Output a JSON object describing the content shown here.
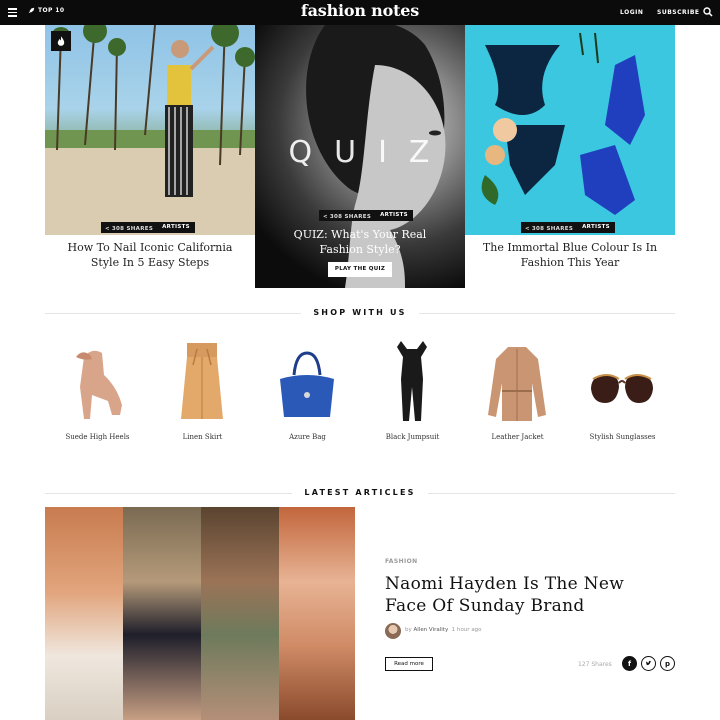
{
  "header": {
    "top10_label": "TOP 10",
    "brand": "fashion notes",
    "login": "LOGIN",
    "subscribe": "SUBSCRIBE"
  },
  "hero": {
    "cards": [
      {
        "shares": "308 SHARES",
        "category": "ARTISTS",
        "title": "How To Nail Iconic California Style In 5 Easy Steps"
      },
      {
        "overlay_word": "QUIZ",
        "shares": "308 SHARES",
        "category": "ARTISTS",
        "title": "QUIZ: What's Your Real Fashion Style?",
        "button": "PLAY THE QUIZ"
      },
      {
        "shares": "308 SHARES",
        "category": "ARTISTS",
        "title": "The Immortal Blue Colour Is In Fashion This Year"
      }
    ]
  },
  "shop": {
    "heading": "SHOP WITH US",
    "items": [
      {
        "label": "Suede High Heels",
        "icon": "heels-icon"
      },
      {
        "label": "Linen Skirt",
        "icon": "skirt-icon"
      },
      {
        "label": "Azure Bag",
        "icon": "bag-icon"
      },
      {
        "label": "Black Jumpsuit",
        "icon": "jumpsuit-icon"
      },
      {
        "label": "Leather Jacket",
        "icon": "jacket-icon"
      },
      {
        "label": "Stylish Sunglasses",
        "icon": "sunglasses-icon"
      }
    ]
  },
  "latest": {
    "heading": "LATEST ARTICLES",
    "article": {
      "category": "FASHION",
      "title": "Naomi Hayden Is The New Face Of Sunday Brand",
      "by": "by",
      "author": "Allen Virality",
      "time": "1 hour ago",
      "read_more": "Read more",
      "share_count": "127 Shares"
    }
  },
  "colors": {
    "topbar": "#0b0b0b",
    "hero3_bg": "#3ac7df",
    "accent_blue": "#1f3fbf"
  }
}
